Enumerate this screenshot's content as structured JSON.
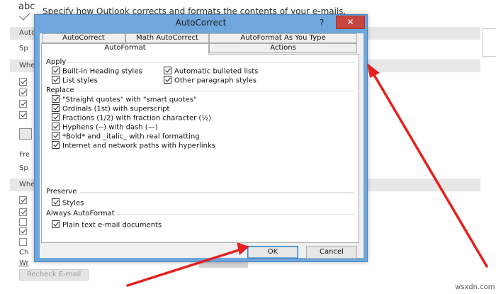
{
  "background": {
    "abc_label": "abc",
    "intro": "Specify how Outlook corrects and formats the contents of your e-mails.",
    "fragments": [
      "Auto",
      "Sp",
      "Whe",
      "Fre",
      "Sp",
      "Whe",
      "Ch",
      "Wr"
    ],
    "checks": [
      true,
      true,
      true,
      true,
      false,
      true,
      true,
      true,
      false,
      true,
      false
    ],
    "recheck_button": "Recheck E-mail"
  },
  "dialog": {
    "title": "AutoCorrect",
    "help_glyph": "?",
    "close_glyph": "✕",
    "tabs_row1": [
      {
        "label": "AutoCorrect"
      },
      {
        "label": "Math AutoCorrect"
      },
      {
        "label": "AutoFormat As You Type"
      }
    ],
    "tabs_row2": [
      {
        "label": "AutoFormat",
        "active": true
      },
      {
        "label": "Actions",
        "active": false
      }
    ],
    "apply": {
      "label": "Apply",
      "options": [
        {
          "label": "Built-in Heading styles",
          "checked": true
        },
        {
          "label": "Automatic bulleted lists",
          "checked": true
        },
        {
          "label": "List styles",
          "checked": true
        },
        {
          "label": "Other paragraph styles",
          "checked": true
        }
      ]
    },
    "replace": {
      "label": "Replace",
      "options": [
        {
          "label": "\"Straight quotes\" with \"smart quotes\"",
          "checked": true
        },
        {
          "label": "Ordinals (1st) with superscript",
          "checked": true
        },
        {
          "label": "Fractions (1/2) with fraction character (½)",
          "checked": true
        },
        {
          "label": "Hyphens (--) with dash (—)",
          "checked": true
        },
        {
          "label": "*Bold* and _italic_ with real formatting",
          "checked": true
        },
        {
          "label": "Internet and network paths with hyperlinks",
          "checked": true
        }
      ]
    },
    "preserve": {
      "label": "Preserve",
      "options": [
        {
          "label": "Styles",
          "checked": true
        }
      ]
    },
    "always": {
      "label": "Always AutoFormat",
      "options": [
        {
          "label": "Plain text e-mail documents",
          "checked": true
        }
      ]
    },
    "ok_button": "OK",
    "cancel_button": "Cancel"
  },
  "watermark": "wsxdn.com",
  "colors": {
    "title_bar": "#6fa7dc",
    "close_button": "#c7463f",
    "arrow": "#e3211f"
  }
}
